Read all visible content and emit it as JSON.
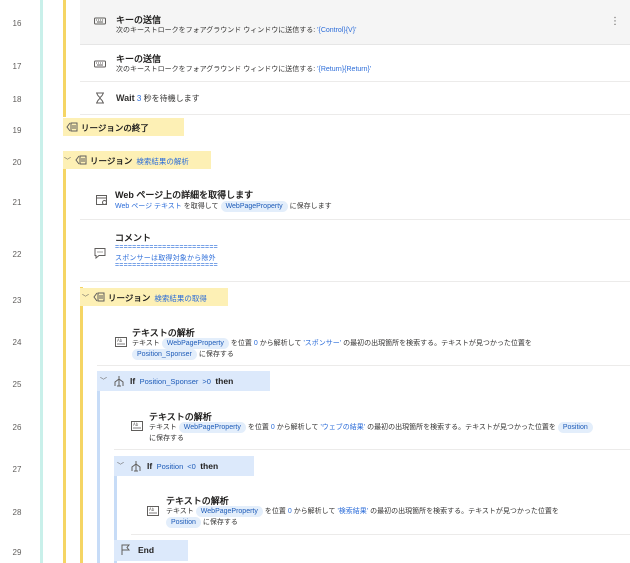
{
  "line_numbers": [
    "16",
    "17",
    "18",
    "19",
    "20",
    "21",
    "22",
    "23",
    "24",
    "25",
    "26",
    "27",
    "28",
    "29"
  ],
  "actions": {
    "send_keys_1": {
      "title": "キーの送信",
      "sub_prefix": "次のキーストロークをフォアグラウンド ウィンドウに送信する: ",
      "sub_value": "'{Control}{V}'"
    },
    "send_keys_2": {
      "title": "キーの送信",
      "sub_prefix": "次のキーストロークをフォアグラウンド ウィンドウに送信する: ",
      "sub_value": "'{Return}{Return}'"
    },
    "wait": {
      "title": "Wait",
      "value": "3",
      "suffix": "秒を待機します"
    },
    "region_end": {
      "label": "リージョンの終了"
    },
    "region_parse": {
      "label": "リージョン",
      "name": "検索結果の解析"
    },
    "web_details": {
      "title": "Web ページ上の詳細を取得します",
      "sub_link": "Web ページ テキスト",
      "sub_mid": "を取得して",
      "pill": "WebPageProperty",
      "sub_end": "に保存します"
    },
    "comment": {
      "title": "コメント",
      "line1": "========================",
      "line2": "スポンサーは取得対象から除外",
      "line3": "========================"
    },
    "region_get": {
      "label": "リージョン",
      "name": "検索結果の取得"
    },
    "parse1": {
      "title": "テキストの解析",
      "a": "テキスト",
      "pill1": "WebPageProperty",
      "b": "を位置",
      "pos": "0",
      "c": "から解析して",
      "search": "'スポンサー'",
      "d": "の最初の出現箇所を検索する。テキストが見つかった位置を",
      "pill2": "Position_Sponser",
      "e": "に保存する"
    },
    "if1": {
      "kw": "If",
      "pill": "Position_Sponser",
      "cond": ">0",
      "then": "then"
    },
    "parse2": {
      "title": "テキストの解析",
      "a": "テキスト",
      "pill1": "WebPageProperty",
      "b": "を位置",
      "pos": "0",
      "c": "から解析して",
      "search": "'ウェブの結果'",
      "d": "の最初の出現箇所を検索する。テキストが見つかった位置を",
      "pill2": "Position",
      "e": "に保存する"
    },
    "if2": {
      "kw": "If",
      "pill": "Position",
      "cond": "<0",
      "then": "then"
    },
    "parse3": {
      "title": "テキストの解析",
      "a": "テキスト",
      "pill1": "WebPageProperty",
      "b": "を位置",
      "pos": "0",
      "c": "から解析して",
      "search": "'検索結果'",
      "d": "の最初の出現箇所を検索する。テキストが見つかった位置を",
      "pill2": "Position",
      "e": "に保存する"
    },
    "end": {
      "label": "End"
    }
  },
  "more_glyph": "⋮"
}
